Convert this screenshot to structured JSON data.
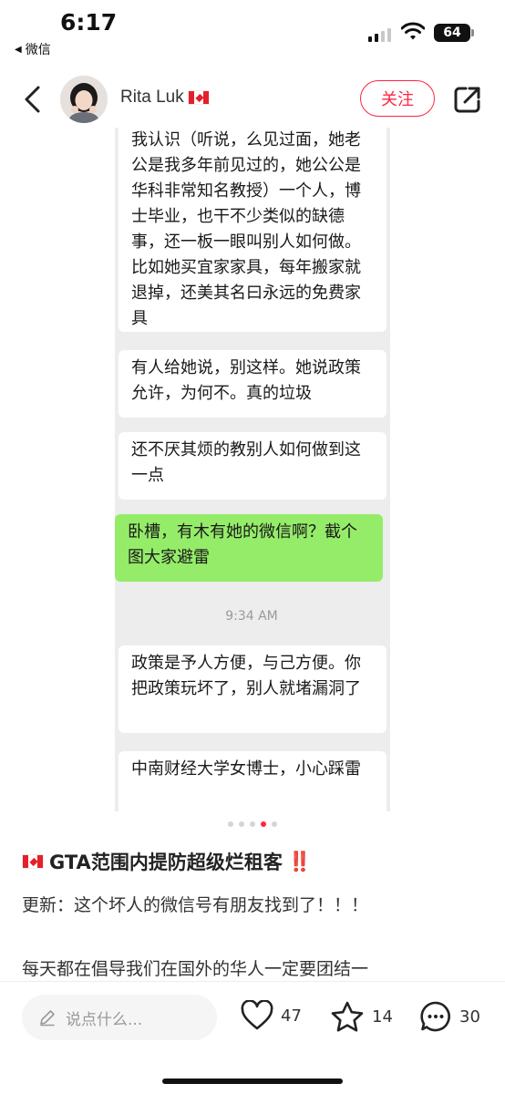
{
  "status_bar": {
    "time": "6:17",
    "back_app": "微信",
    "battery": "64"
  },
  "header": {
    "author_name": "Rita Luk",
    "follow_label": "关注"
  },
  "chat": {
    "messages": [
      {
        "side": "left",
        "text": "我认识（听说，么见过面，她老公是我多年前见过的，她公公是华科非常知名教授）一个人，博士毕业，也干不少类似的缺德事，还一板一眼叫别人如何做。比如她买宜家家具，每年搬家就退掉，还美其名曰永远的免费家具"
      },
      {
        "side": "left",
        "text": "有人给她说，别这样。她说政策允许，为何不。真的垃圾"
      },
      {
        "side": "left",
        "text": "还不厌其烦的教别人如何做到这一点"
      },
      {
        "side": "right",
        "text": "卧槽，有木有她的微信啊？截个图大家避雷"
      },
      {
        "side": "left",
        "text": "政策是予人方便，与己方便。你把政策玩坏了，别人就堵漏洞了"
      },
      {
        "side": "left",
        "text": "中南财经大学女博士，小心踩雷"
      }
    ],
    "timestamp": "9:34 AM"
  },
  "carousel": {
    "total": 5,
    "active_index": 3
  },
  "post": {
    "title": "GTA范围内提防超级烂租客",
    "title_suffix": "‼️",
    "update": "更新：这个坏人的微信号有朋友找到了！！！",
    "body": "每天都在倡导我们在国外的华人一定要团结一"
  },
  "bottom_bar": {
    "comment_placeholder": "说点什么...",
    "likes": "47",
    "collects": "14",
    "comments": "30"
  },
  "colors": {
    "accent": "#ff2442",
    "chat_green": "#95ec69",
    "chat_bg": "#ededed"
  }
}
